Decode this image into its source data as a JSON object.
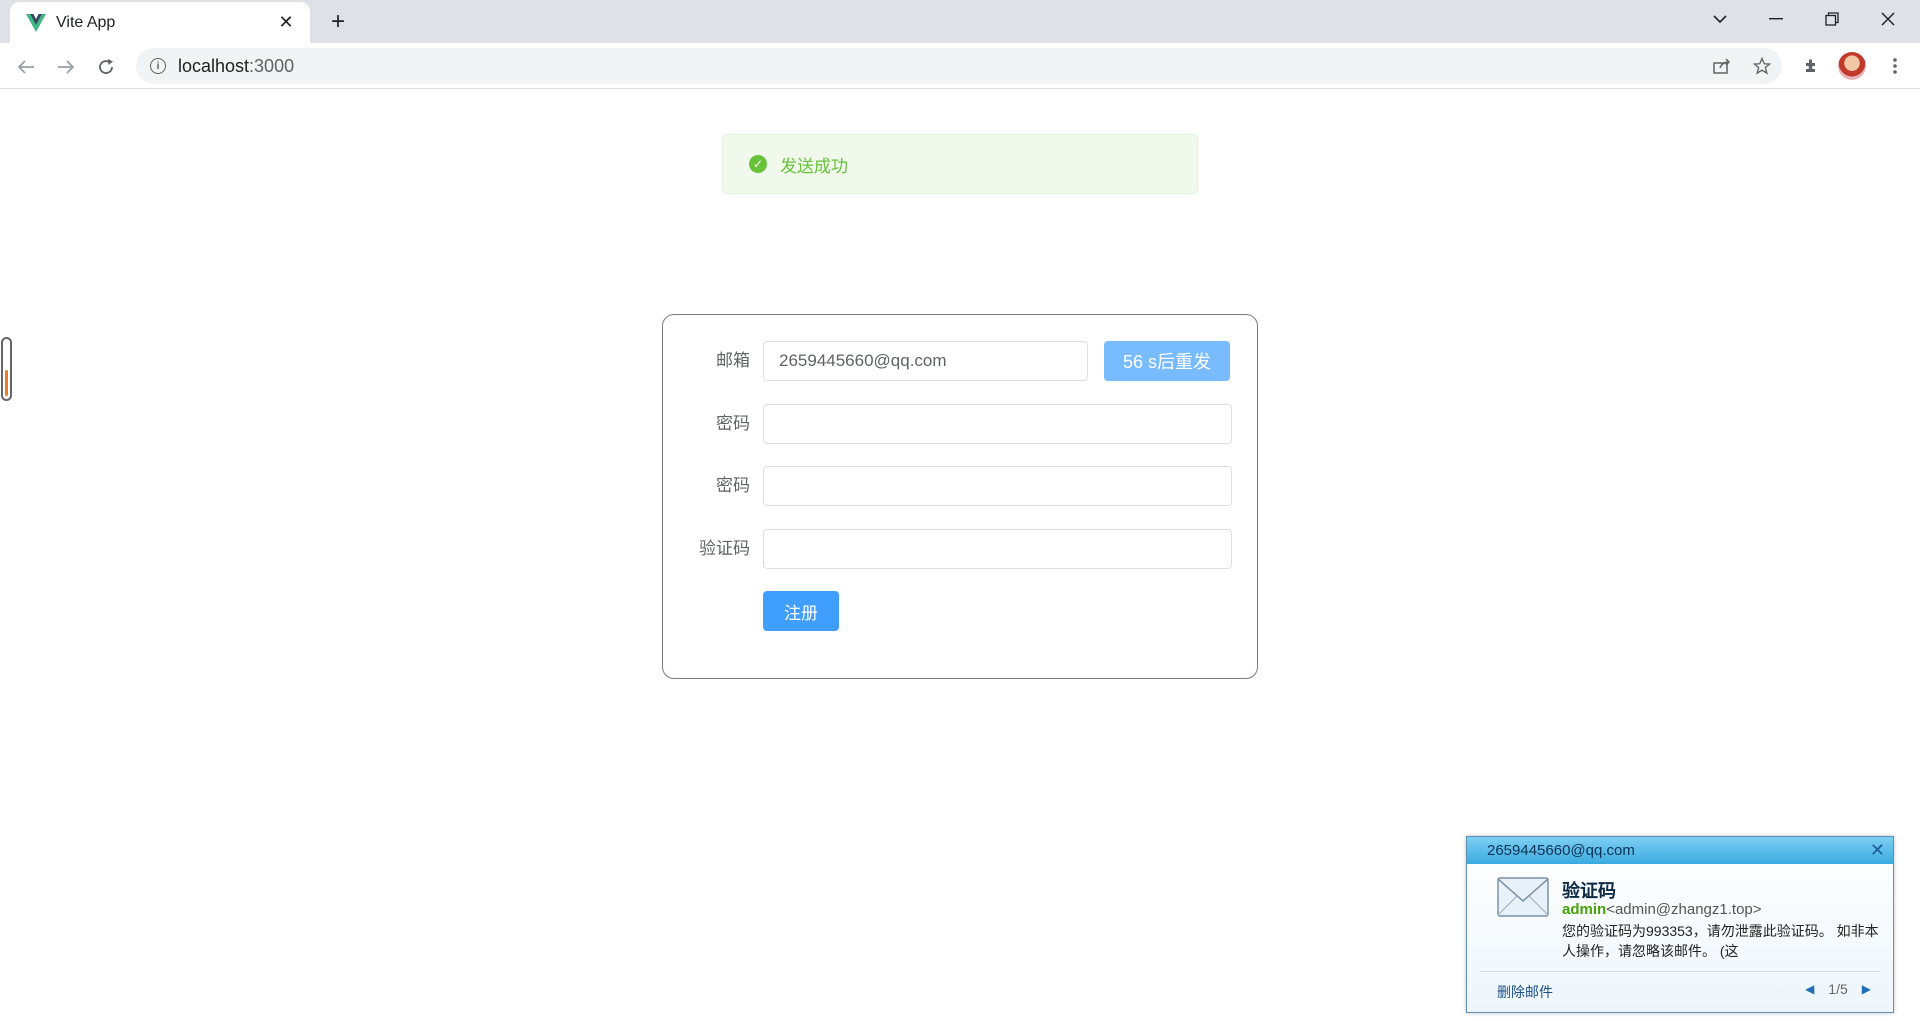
{
  "browser": {
    "tab_title": "Vite App",
    "tab_close": "✕",
    "new_tab": "+",
    "url_host": "localhost",
    "url_port": ":3000"
  },
  "message": {
    "text": "发送成功",
    "type": "success"
  },
  "form": {
    "email_label": "邮箱",
    "email_value": "2659445660@qq.com",
    "resend_label": "56 s后重发",
    "password_label": "密码",
    "password_value": "",
    "confirm_password_label": "密码",
    "confirm_password_value": "",
    "code_label": "验证码",
    "code_value": "",
    "submit_label": "注册"
  },
  "mail_notification": {
    "account": "2659445660@qq.com",
    "subject": "验证码",
    "sender_name": "admin",
    "sender_email": "<admin@zhangz1.top>",
    "body": "您的验证码为993353，请勿泄露此验证码。 如非本人操作，请忽略该邮件。 (这",
    "delete_label": "删除邮件",
    "pager": "1/5"
  },
  "colors": {
    "primary": "#409eff",
    "primary_light": "#79bbff",
    "success": "#67c23a"
  }
}
